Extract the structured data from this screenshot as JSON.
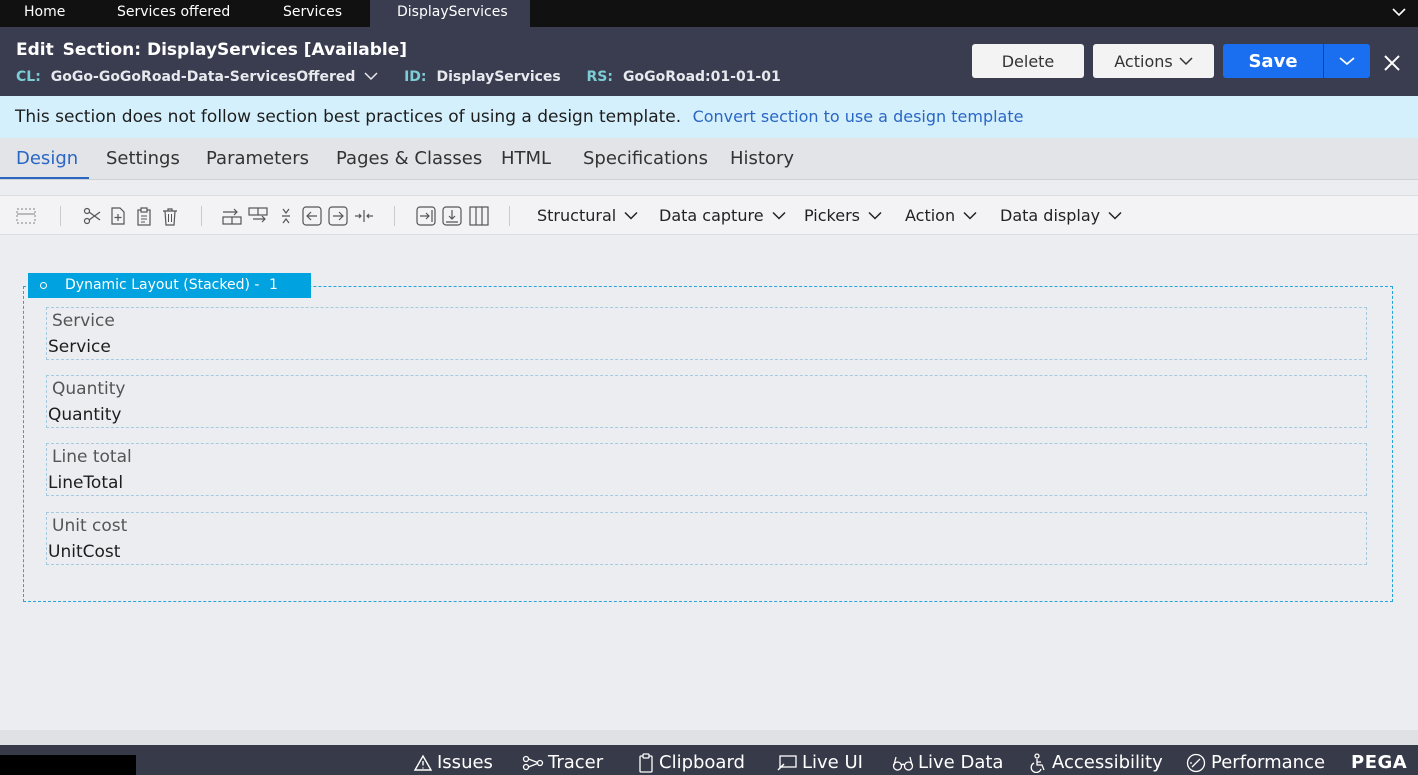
{
  "top_tabs": [
    "Home",
    "Services offered",
    "Services",
    "DisplayServices"
  ],
  "header": {
    "edit_label": "Edit",
    "title": "Section: DisplayServices [Available]",
    "cl_key": "CL:",
    "cl_value": "GoGo-GoGoRoad-Data-ServicesOffered",
    "id_key": "ID:",
    "id_value": "DisplayServices",
    "rs_key": "RS:",
    "rs_value": "GoGoRoad:01-01-01",
    "delete_label": "Delete",
    "actions_label": "Actions",
    "save_label": "Save"
  },
  "banner": {
    "text": "This section does not follow section best practices of using a design template.",
    "link": "Convert section to use a design template"
  },
  "rule_tabs": [
    "Design",
    "Settings",
    "Parameters",
    "Pages & Classes",
    "HTML",
    "Specifications",
    "History"
  ],
  "toolbar": {
    "icons": [
      "select-layout-icon",
      "cut-icon",
      "add-icon",
      "paste-icon",
      "delete-icon",
      "insert-row-icon",
      "insert-row-above-icon",
      "collapse-icon",
      "move-left-icon",
      "move-right-icon",
      "split-icon",
      "insert-right-icon",
      "insert-below-icon",
      "columns-icon"
    ],
    "menus": [
      "Structural",
      "Data capture",
      "Pickers",
      "Action",
      "Data display"
    ]
  },
  "layout": {
    "title": "Dynamic Layout (Stacked) -",
    "count": "1",
    "fields": [
      {
        "label": "Service",
        "value": "Service"
      },
      {
        "label": "Quantity",
        "value": "Quantity"
      },
      {
        "label": "Line total",
        "value": "LineTotal"
      },
      {
        "label": "Unit cost",
        "value": "UnitCost"
      }
    ]
  },
  "footer": {
    "items": [
      "Issues",
      "Tracer",
      "Clipboard",
      "Live UI",
      "Live Data",
      "Accessibility",
      "Performance"
    ],
    "brand": "PEGA"
  },
  "colors": {
    "header_bg": "#3a3d4f",
    "accent_blue": "#1a6ff0",
    "link_blue": "#2a66c4",
    "banner_bg": "#d4f0fc",
    "layout_header_bg": "#00a2e0"
  }
}
